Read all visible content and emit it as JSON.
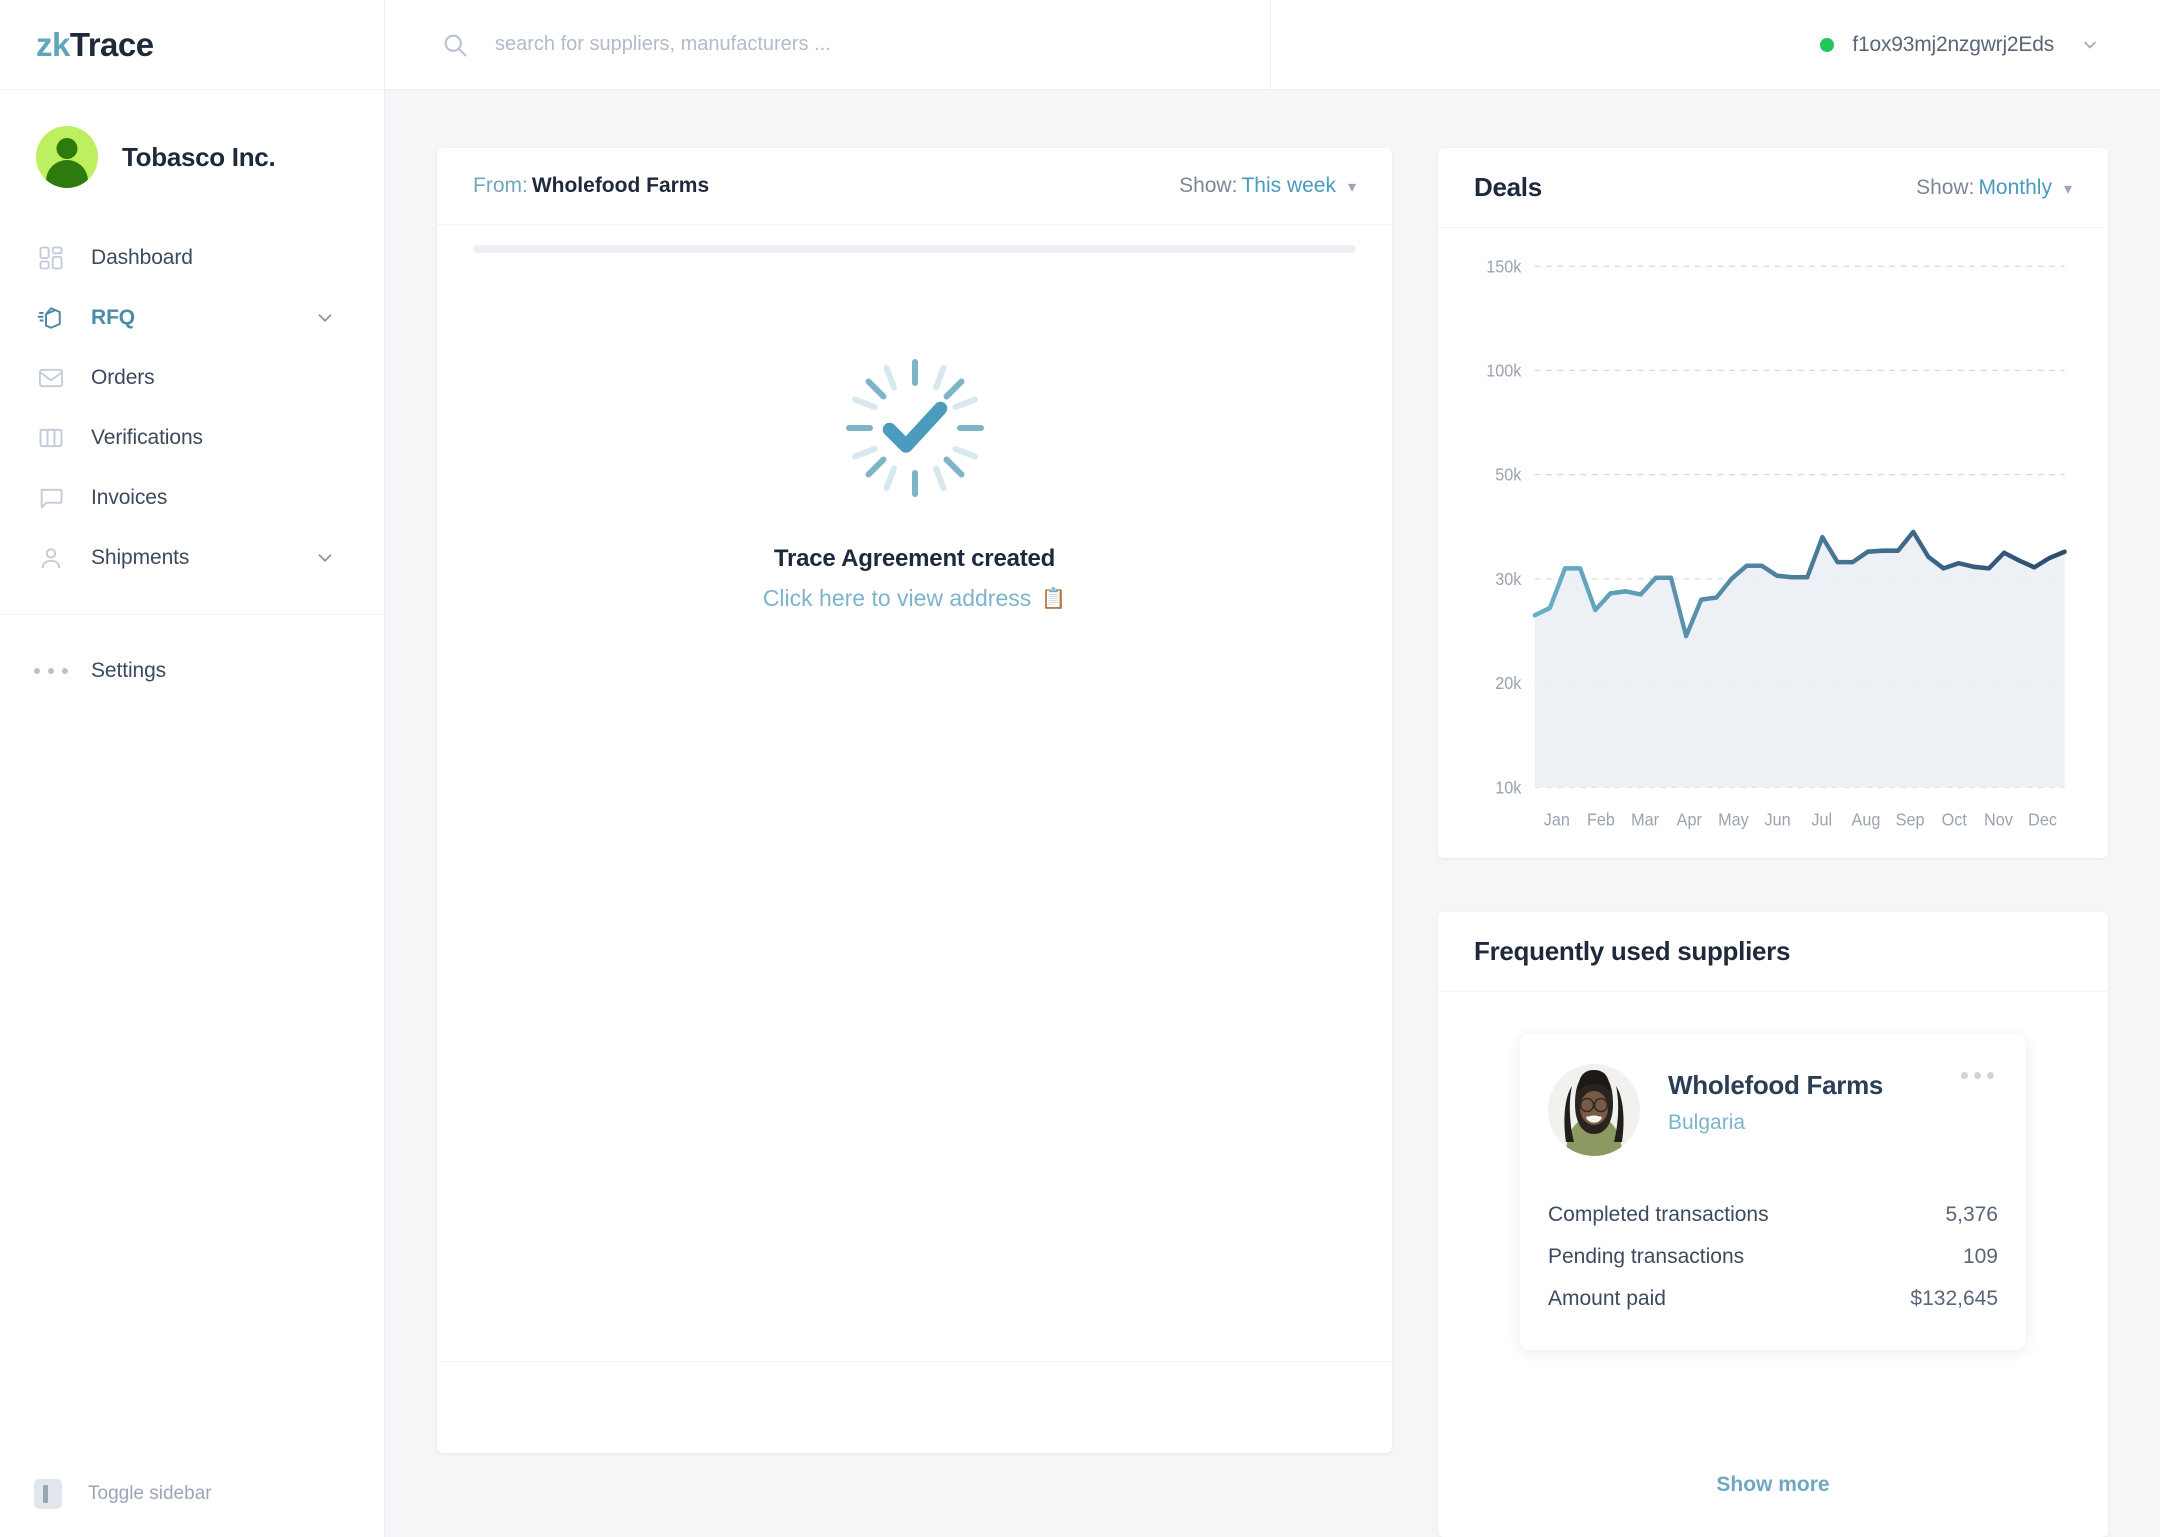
{
  "brand": {
    "prefix": "zk",
    "suffix": "Trace"
  },
  "sidebar": {
    "org_name": "Tobasco Inc.",
    "items": [
      {
        "label": "Dashboard",
        "icon": "dashboard-icon",
        "active": false,
        "expandable": false
      },
      {
        "label": "RFQ",
        "icon": "rfq-box-icon",
        "active": true,
        "expandable": true
      },
      {
        "label": "Orders",
        "icon": "envelope-icon",
        "active": false,
        "expandable": false
      },
      {
        "label": "Verifications",
        "icon": "columns-icon",
        "active": false,
        "expandable": false
      },
      {
        "label": "Invoices",
        "icon": "chat-bubble-icon",
        "active": false,
        "expandable": false
      },
      {
        "label": "Shipments",
        "icon": "person-icon",
        "active": false,
        "expandable": true
      }
    ],
    "settings_label": "Settings",
    "toggle_label": "Toggle sidebar"
  },
  "topbar": {
    "search_placeholder": "search for suppliers, manufacturers ...",
    "search_value": "",
    "wallet_address": "f1ox93mj2nzgwrj2Eds",
    "wallet_status_color": "#22c55e"
  },
  "trace_card": {
    "from_label": "From:",
    "from_value": "Wholefood Farms",
    "show_label": "Show:",
    "show_value": "This week",
    "status_title": "Trace Agreement created",
    "link_text": "Click here to view address",
    "link_icon": "clipboard-copy-icon"
  },
  "deals": {
    "title": "Deals",
    "show_label": "Show:",
    "show_value": "Monthly"
  },
  "chart_data": {
    "type": "area",
    "title": "Deals",
    "xlabel": "",
    "ylabel": "",
    "grid": true,
    "legend": false,
    "ytick_labels": [
      "150k",
      "100k",
      "50k",
      "30k",
      "20k",
      "10k"
    ],
    "ytick_values": [
      150000,
      100000,
      50000,
      30000,
      20000,
      10000
    ],
    "categories": [
      "Jan",
      "Feb",
      "Mar",
      "Apr",
      "May",
      "Jun",
      "Jul",
      "Aug",
      "Sep",
      "Oct",
      "Nov",
      "Dec"
    ],
    "x": [
      0,
      1,
      2,
      3,
      4,
      5,
      6,
      7,
      8,
      9,
      10,
      11,
      12,
      13,
      14,
      15,
      16,
      17,
      18,
      19,
      20,
      21,
      22,
      23,
      24,
      25,
      26,
      27,
      28,
      29,
      30,
      31,
      32,
      33,
      34,
      35
    ],
    "values": [
      26500,
      27200,
      32000,
      32000,
      27000,
      28600,
      28800,
      28500,
      30200,
      30200,
      24500,
      28000,
      28200,
      30000,
      32500,
      32500,
      30600,
      30300,
      30300,
      38000,
      33200,
      33200,
      35200,
      35400,
      35400,
      39000,
      34200,
      32000,
      33000,
      32300,
      32000,
      35000,
      33500,
      32200,
      34000,
      35200
    ],
    "ylim": [
      10000,
      150000
    ],
    "line_color_start": "#6aaec6",
    "line_color_end": "#2b4b6f",
    "area_fill": "#eaeff3"
  },
  "suppliers": {
    "title": "Frequently used suppliers",
    "show_more_label": "Show more",
    "items": [
      {
        "name": "Wholefood Farms",
        "country": "Bulgaria",
        "stats": [
          {
            "key": "Completed transactions",
            "value": "5,376"
          },
          {
            "key": "Pending transactions",
            "value": "109"
          },
          {
            "key": "Amount paid",
            "value": "$132,645"
          }
        ]
      }
    ]
  }
}
